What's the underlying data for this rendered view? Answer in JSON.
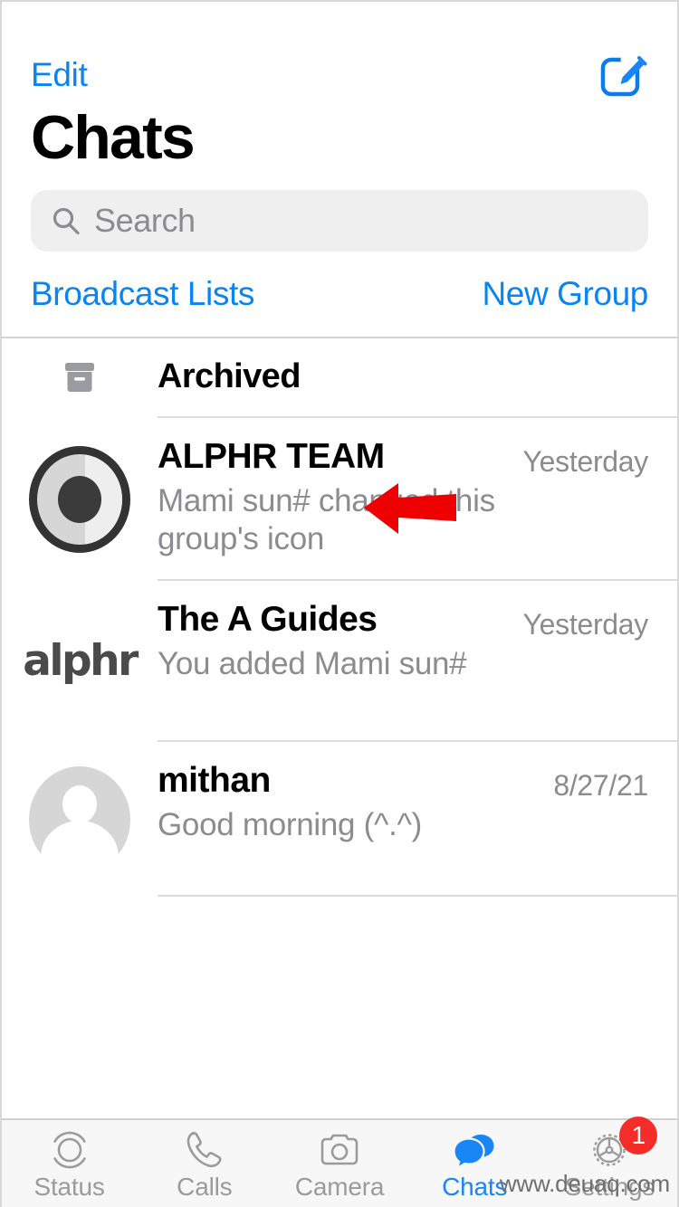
{
  "theme": {
    "accent_blue": "#0a84f0",
    "badge_red": "#f42d28",
    "arrow_red": "#ee0000",
    "secondary_text": "#8b8b90",
    "search_bg": "#efefef",
    "tabbar_bg": "#f7f7f7"
  },
  "navbar": {
    "edit_label": "Edit",
    "compose_icon": "compose-icon"
  },
  "header": {
    "title": "Chats"
  },
  "search": {
    "placeholder": "Search",
    "icon": "search-icon",
    "value": ""
  },
  "quick_links": {
    "broadcast_label": "Broadcast Lists",
    "new_group_label": "New Group"
  },
  "archived": {
    "label": "Archived",
    "icon": "archive-box-icon"
  },
  "chats": [
    {
      "name": "ALPHR TEAM",
      "preview": "Mami sun# changed this group's icon",
      "time": "Yesterday",
      "avatar": "alphr-team-eye-avatar"
    },
    {
      "name": "The A Guides",
      "preview": "You added Mami sun#",
      "time": "Yesterday",
      "avatar": "alphr-logo-avatar",
      "avatar_text": "alphr"
    },
    {
      "name": "mithan",
      "preview": "Good morning (^.^)",
      "time": "8/27/21",
      "avatar": "default-person-avatar"
    }
  ],
  "annotation": {
    "type": "red-left-arrow",
    "points_at": "ALPHR TEAM"
  },
  "tabbar": {
    "items": [
      {
        "label": "Status",
        "icon": "status-rings-icon",
        "active": false,
        "badge": ""
      },
      {
        "label": "Calls",
        "icon": "phone-icon",
        "active": false,
        "badge": ""
      },
      {
        "label": "Camera",
        "icon": "camera-icon",
        "active": false,
        "badge": ""
      },
      {
        "label": "Chats",
        "icon": "chat-bubbles-icon",
        "active": true,
        "badge": ""
      },
      {
        "label": "Settings",
        "icon": "gear-icon",
        "active": false,
        "badge": "1"
      }
    ]
  },
  "watermark": {
    "text": "www.deuaq.com"
  }
}
